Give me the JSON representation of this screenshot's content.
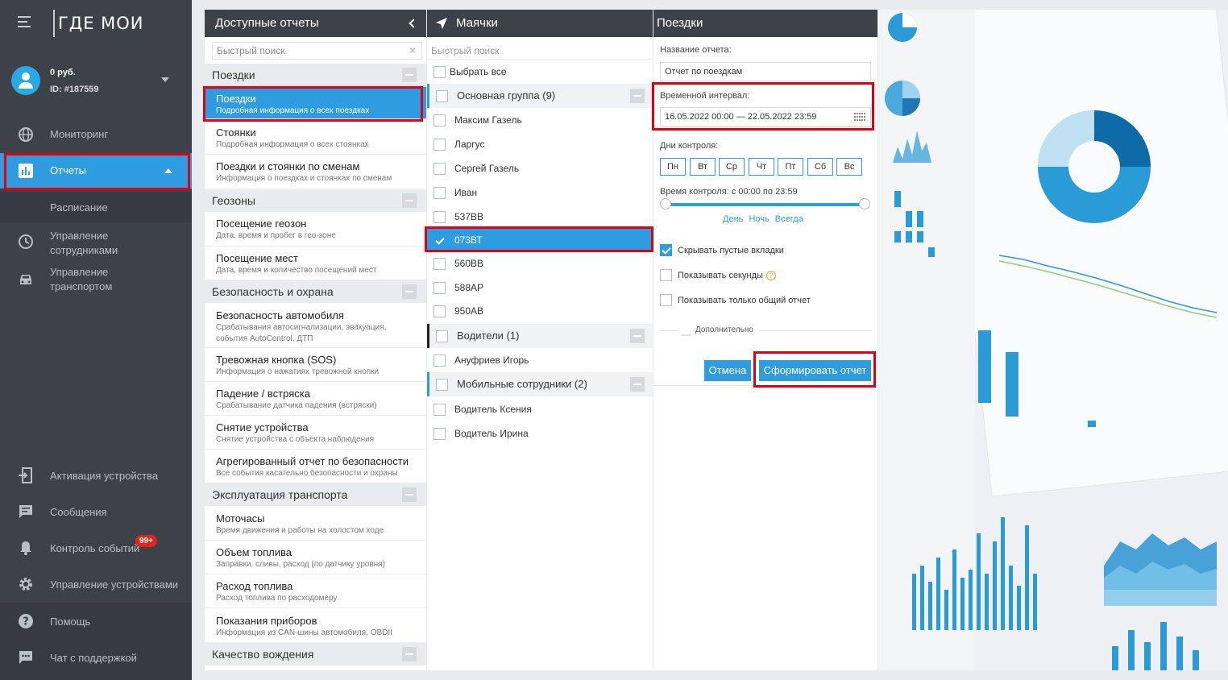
{
  "sidebar": {
    "logo": "ГДЕ МОИ",
    "balance": "0 руб.",
    "user_id": "ID: #187559",
    "nav": [
      {
        "label": "Мониторинг"
      },
      {
        "label": "Отчеты"
      },
      {
        "label": "Расписание"
      },
      {
        "label": "Управление сотрудниками"
      },
      {
        "label": "Управление транспортом"
      }
    ],
    "bottom_nav": [
      {
        "label": "Активация устройства"
      },
      {
        "label": "Сообщения"
      },
      {
        "label": "Контроль событий",
        "badge": "99+"
      },
      {
        "label": "Управление устройствами"
      },
      {
        "label": "Помощь"
      },
      {
        "label": "Чат с поддержкой"
      }
    ],
    "accent_color": "#2f9ce0"
  },
  "reports_panel": {
    "title": "Доступные отчеты",
    "search_placeholder": "Быстрый поиск",
    "categories": [
      {
        "name": "Поездки"
      },
      {
        "name": "Геозоны"
      },
      {
        "name": "Безопасность и охрана"
      },
      {
        "name": "Эксплуатация транспорта"
      },
      {
        "name": "Качество вождения"
      }
    ],
    "reports": [
      {
        "title": "Поездки",
        "desc": "Подробная информация о всех поездках",
        "selected": true
      },
      {
        "title": "Стоянки",
        "desc": "Подробная информация о всех стоянках"
      },
      {
        "title": "Поездки и стоянки по сменам",
        "desc": "Информация о поездках и стоянках по сменам"
      },
      {
        "title": "Посещение геозон",
        "desc": "Дата, время и пробег в гео-зоне"
      },
      {
        "title": "Посещение мест",
        "desc": "Дата, время и количество посещений мест"
      },
      {
        "title": "Безопасность автомобиля",
        "desc": "Срабатывания автосигнализации, эвакуация,",
        "desc2": "события AutoControl, ДТП"
      },
      {
        "title": "Тревожная кнопка (SOS)",
        "desc": "Информация о нажатиях тревожной кнопки"
      },
      {
        "title": "Падение / встряска",
        "desc": "Срабатывание датчика падения (встряски)"
      },
      {
        "title": "Снятие устройства",
        "desc": "Снятие устройства с объекта наблюдения"
      },
      {
        "title": "Агрегированный отчет по безопасности",
        "desc": "Все события касательно безопасности и охраны"
      },
      {
        "title": "Моточасы",
        "desc": "Время движения и работы на холостом ходе"
      },
      {
        "title": "Объем топлива",
        "desc": "Заправки, сливы, расход (по датчику уровня)"
      },
      {
        "title": "Расход топлива",
        "desc": "Расход топлива по расходомеру"
      },
      {
        "title": "Показания приборов",
        "desc": "Информация из CAN-шины автомобиля, OBDII"
      }
    ]
  },
  "beacons_panel": {
    "title": "Маячки",
    "search_placeholder": "Быстрый поиск",
    "select_all": "Выбрать все",
    "groups": [
      {
        "name": "Основная группа (9)"
      },
      {
        "name": "Водители (1)"
      },
      {
        "name": "Мобильные сотрудники (2)"
      }
    ],
    "items": [
      {
        "name": "Максим Газель"
      },
      {
        "name": "Ларгус"
      },
      {
        "name": "Сергей Газель"
      },
      {
        "name": "Иван"
      },
      {
        "name": "537ВВ"
      },
      {
        "name": "073ВТ",
        "checked": true
      },
      {
        "name": "560ВВ"
      },
      {
        "name": "588АР"
      },
      {
        "name": "950АВ"
      },
      {
        "name": "Ануфриев Игорь"
      },
      {
        "name": "Водитель Ксения"
      },
      {
        "name": "Водитель Ирина"
      }
    ]
  },
  "trips_panel": {
    "title": "Поездки",
    "report_name_label": "Название отчета:",
    "report_name_value": "Отчет по поездкам",
    "interval_label": "Временной интервал:",
    "interval_value": "16.05.2022 00:00 — 22.05.2022 23:59",
    "days_label": "Дни контроля:",
    "days": [
      "Пн",
      "Вт",
      "Ср",
      "Чт",
      "Пт",
      "Сб",
      "Вс"
    ],
    "time_label": "Время контроля: с 00:00 по 23:59",
    "time_links": [
      "День",
      "Ночь",
      "Всегда"
    ],
    "opt_hide_empty": "Скрывать пустые вкладки",
    "opt_seconds": "Показывать секунды",
    "opt_total_only": "Показывать только общий отчет",
    "additional": "Дополнительно",
    "cancel": "Отмена",
    "submit": "Сформировать отчет"
  },
  "highlight_color": "#e00010"
}
